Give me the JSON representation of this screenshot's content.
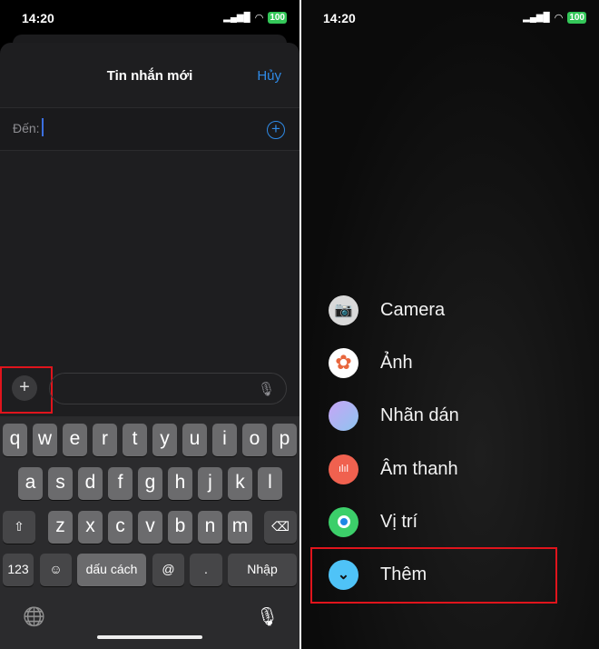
{
  "status": {
    "time": "14:20",
    "battery": "100"
  },
  "compose": {
    "title": "Tin nhắn mới",
    "cancel": "Hủy",
    "to_label": "Đến:"
  },
  "keyboard": {
    "row1": [
      "q",
      "w",
      "e",
      "r",
      "t",
      "y",
      "u",
      "i",
      "o",
      "p"
    ],
    "row2": [
      "a",
      "s",
      "d",
      "f",
      "g",
      "h",
      "j",
      "k",
      "l"
    ],
    "row3": [
      "z",
      "x",
      "c",
      "v",
      "b",
      "n",
      "m"
    ],
    "numbers": "123",
    "space": "dấu cách",
    "at": "@",
    "dot": ".",
    "return": "Nhập"
  },
  "menu": {
    "items": [
      {
        "label": "Camera",
        "icon": "camera-icon",
        "color": "#d9d9d9"
      },
      {
        "label": "Ảnh",
        "icon": "photos-icon",
        "color": "#ffffff"
      },
      {
        "label": "Nhãn dán",
        "icon": "sticker-icon",
        "color": "#9fb4f0"
      },
      {
        "label": "Âm thanh",
        "icon": "audio-waveform-icon",
        "color": "#f0614f"
      },
      {
        "label": "Vị trí",
        "icon": "location-icon",
        "color": "#3ccf6a"
      },
      {
        "label": "Thêm",
        "icon": "chevron-down-icon",
        "color": "#4fc3f7"
      }
    ]
  },
  "highlight_color": "#e0141c"
}
